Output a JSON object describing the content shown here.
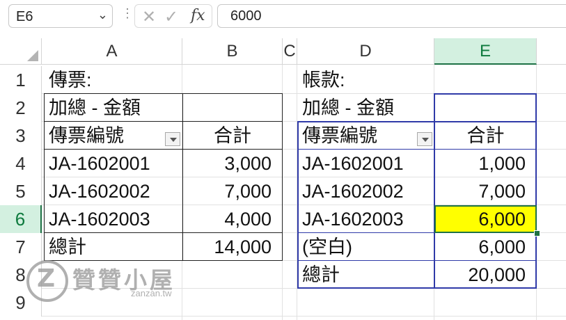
{
  "formula_bar": {
    "name_box": "E6",
    "fx_label": "fx",
    "formula": "6000"
  },
  "columns": [
    "A",
    "B",
    "C",
    "D",
    "E"
  ],
  "rows": [
    "1",
    "2",
    "3",
    "4",
    "5",
    "6",
    "7",
    "8",
    "9"
  ],
  "active_cell": "E6",
  "cells": {
    "A1": "傳票:",
    "A2": "加總 - 金額",
    "A3": "傳票編號",
    "B3": "合計",
    "A4": "JA-1602001",
    "B4": "3,000",
    "A5": "JA-1602002",
    "B5": "7,000",
    "A6": "JA-1602003",
    "B6": "4,000",
    "A7": "總計",
    "B7": "14,000",
    "D1": "帳款:",
    "D2": "加總 - 金額",
    "D3": "傳票編號",
    "E3": "合計",
    "D4": "JA-1602001",
    "E4": "1,000",
    "D5": "JA-1602002",
    "E5": "7,000",
    "D6": "JA-1602003",
    "E6": "6,000",
    "D7": "(空白)",
    "E7": "6,000",
    "D8": "總計",
    "E8": "20,000"
  },
  "colors": {
    "accent": "#1e7145",
    "highlight": "#ffff00",
    "pivot_border": "#2f3aa8"
  },
  "watermark": {
    "name": "贊贊小屋",
    "url": "zanzan.tw"
  }
}
